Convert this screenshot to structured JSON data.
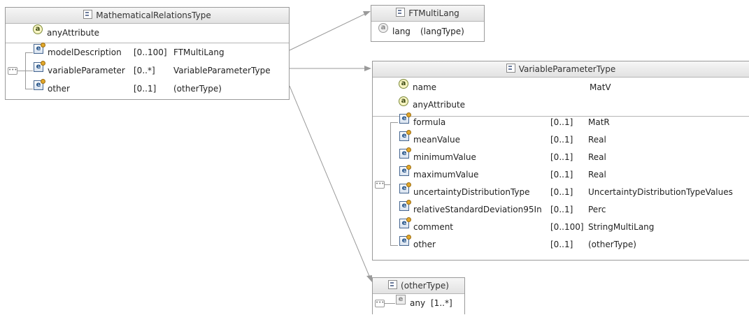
{
  "mathematical_relations_type": {
    "title": "MathematicalRelationsType",
    "attributes": [
      {
        "name": "anyAttribute"
      }
    ],
    "elements": [
      {
        "name": "modelDescription",
        "cardinality": "[0..100]",
        "type": "FTMultiLang"
      },
      {
        "name": "variableParameter",
        "cardinality": "[0..*]",
        "type": "VariableParameterType"
      },
      {
        "name": "other",
        "cardinality": "[0..1]",
        "type": "(otherType)"
      }
    ]
  },
  "ft_multi_lang": {
    "title": "FTMultiLang",
    "attributes": [
      {
        "name": "lang",
        "type": "(langType)"
      }
    ]
  },
  "variable_parameter_type": {
    "title": "VariableParameterType",
    "attributes": [
      {
        "name": "name",
        "type": "MatV"
      },
      {
        "name": "anyAttribute",
        "type": ""
      }
    ],
    "elements": [
      {
        "name": "formula",
        "cardinality": "[0..1]",
        "type": "MatR"
      },
      {
        "name": "meanValue",
        "cardinality": "[0..1]",
        "type": "Real"
      },
      {
        "name": "minimumValue",
        "cardinality": "[0..1]",
        "type": "Real"
      },
      {
        "name": "maximumValue",
        "cardinality": "[0..1]",
        "type": "Real"
      },
      {
        "name": "uncertaintyDistributionType",
        "cardinality": "[0..1]",
        "type": "UncertaintyDistributionTypeValues"
      },
      {
        "name": "relativeStandardDeviation95In",
        "cardinality": "[0..1]",
        "type": "Perc"
      },
      {
        "name": "comment",
        "cardinality": "[0..100]",
        "type": "StringMultiLang"
      },
      {
        "name": "other",
        "cardinality": "[0..1]",
        "type": "(otherType)"
      }
    ]
  },
  "other_type": {
    "title": "(otherType)",
    "elements": [
      {
        "name": "any",
        "cardinality": "[1..*]"
      }
    ]
  },
  "icons": {
    "type": "complex-type-icon",
    "attribute": "attribute-icon",
    "any_attribute": "any-attribute-icon",
    "element": "element-icon",
    "any_element": "any-element-icon",
    "sequence": "sequence-compositor-icon"
  }
}
